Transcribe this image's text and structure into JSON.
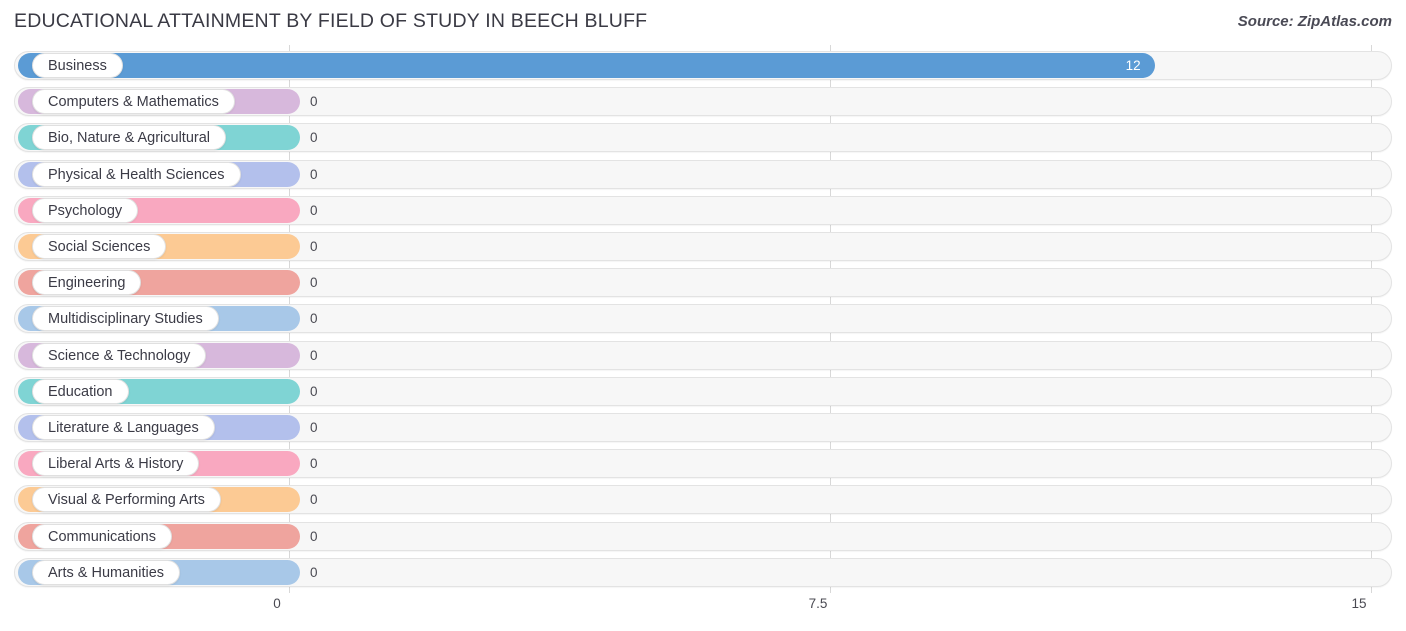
{
  "header": {
    "title": "EDUCATIONAL ATTAINMENT BY FIELD OF STUDY IN BEECH BLUFF",
    "source": "Source: ZipAtlas.com"
  },
  "chart_data": {
    "type": "bar",
    "orientation": "horizontal",
    "title": "EDUCATIONAL ATTAINMENT BY FIELD OF STUDY IN BEECH BLUFF",
    "subtitle": "",
    "xlabel": "",
    "ylabel": "",
    "xlim": [
      0,
      15
    ],
    "ticks": [
      "0",
      "7.5",
      "15"
    ],
    "tick_values": [
      0,
      7.5,
      15
    ],
    "grid": true,
    "legend": "none",
    "categories": [
      "Business",
      "Computers & Mathematics",
      "Bio, Nature & Agricultural",
      "Physical & Health Sciences",
      "Psychology",
      "Social Sciences",
      "Engineering",
      "Multidisciplinary Studies",
      "Science & Technology",
      "Education",
      "Literature & Languages",
      "Liberal Arts & History",
      "Visual & Performing Arts",
      "Communications",
      "Arts & Humanities"
    ],
    "values": [
      12,
      0,
      0,
      0,
      0,
      0,
      0,
      0,
      0,
      0,
      0,
      0,
      0,
      0,
      0
    ],
    "value_labels": [
      "12",
      "0",
      "0",
      "0",
      "0",
      "0",
      "0",
      "0",
      "0",
      "0",
      "0",
      "0",
      "0",
      "0",
      "0"
    ],
    "colors": [
      "#5b9bd5",
      "#d7b8dc",
      "#7fd4d4",
      "#b3c0ec",
      "#f9a8c0",
      "#fcca94",
      "#efa49e",
      "#a8c8e8",
      "#d7b8dc",
      "#7fd4d4",
      "#b3c0ec",
      "#f9a8c0",
      "#fcca94",
      "#efa49e",
      "#a8c8e8"
    ]
  }
}
